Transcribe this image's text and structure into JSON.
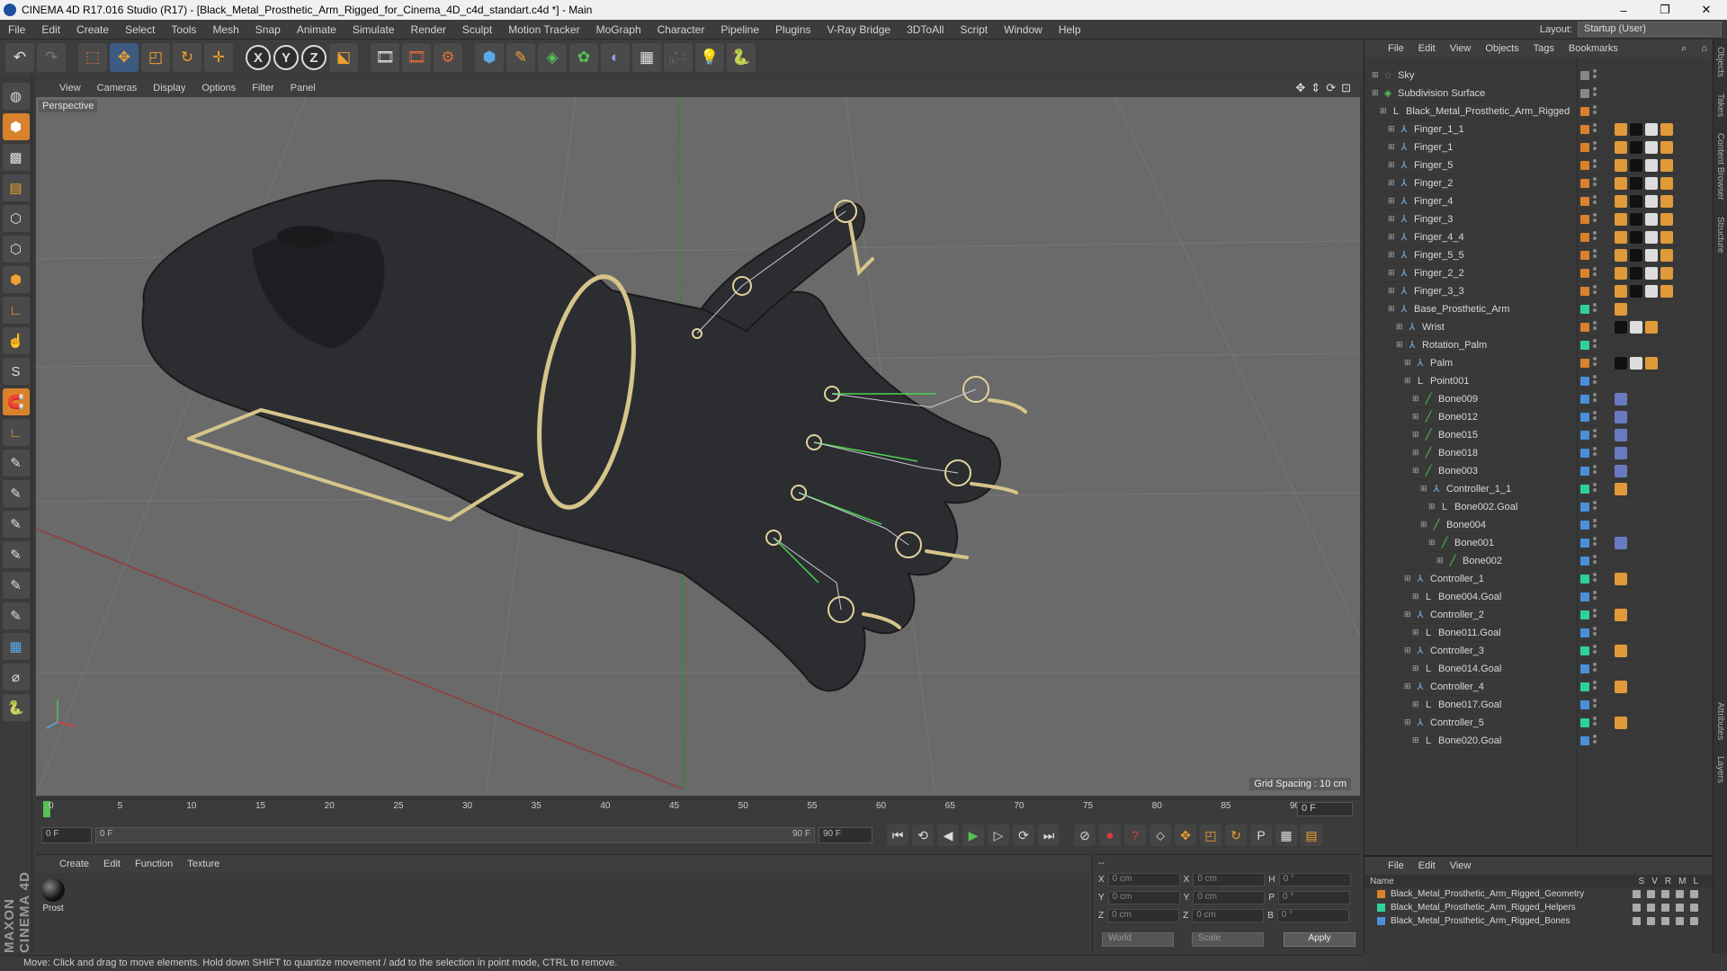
{
  "window": {
    "title": "CINEMA 4D R17.016 Studio (R17) - [Black_Metal_Prosthetic_Arm_Rigged_for_Cinema_4D_c4d_standart.c4d *] - Main",
    "controls": [
      "–",
      "❐",
      "✕"
    ]
  },
  "menubar": {
    "items": [
      "File",
      "Edit",
      "Create",
      "Select",
      "Tools",
      "Mesh",
      "Snap",
      "Animate",
      "Simulate",
      "Render",
      "Sculpt",
      "Motion Tracker",
      "MoGraph",
      "Character",
      "Pipeline",
      "Plugins",
      "V-Ray Bridge",
      "3DToAll",
      "Script",
      "Window",
      "Help"
    ],
    "layout_label": "Layout:",
    "layout_value": "Startup (User)"
  },
  "toolbar": {
    "icons": [
      "undo-icon",
      "redo-icon",
      "live-select-icon",
      "move-icon",
      "scale-icon",
      "rotate-icon",
      "transform-icon",
      "x-axis-icon",
      "y-axis-icon",
      "z-axis-icon",
      "coordinate-system-icon",
      "render-view-icon",
      "render-picture-viewer-icon",
      "edit-render-settings-icon",
      "cube-icon",
      "pen-icon",
      "subdivision-icon",
      "cloner-icon",
      "deformer-icon",
      "floor-icon",
      "camera-icon",
      "light-icon",
      "python-icon"
    ],
    "axis_labels": [
      "X",
      "Y",
      "Z"
    ]
  },
  "viewport": {
    "menu": [
      "View",
      "Cameras",
      "Display",
      "Options",
      "Filter",
      "Panel"
    ],
    "label": "Perspective",
    "grid_spacing": "Grid Spacing : 10 cm",
    "bg_color": "#6a6a6a"
  },
  "timeline": {
    "ticks": [
      "0",
      "5",
      "10",
      "15",
      "20",
      "25",
      "30",
      "35",
      "40",
      "45",
      "50",
      "55",
      "60",
      "65",
      "70",
      "75",
      "80",
      "85",
      "90"
    ],
    "current_frame": "0 F"
  },
  "transport": {
    "start_field": "0 F",
    "range_start": "0 F",
    "range_end": "90 F",
    "end_field": "90 F"
  },
  "material_manager": {
    "menu": [
      "Create",
      "Edit",
      "Function",
      "Texture"
    ],
    "material_name": "Prost"
  },
  "coord_manager": {
    "rows": [
      {
        "a": "X",
        "av": "0 cm",
        "b": "X",
        "bv": "0 cm",
        "c": "H",
        "cv": "0 °"
      },
      {
        "a": "Y",
        "av": "0 cm",
        "b": "Y",
        "bv": "0 cm",
        "c": "P",
        "cv": "0 °"
      },
      {
        "a": "Z",
        "av": "0 cm",
        "b": "Z",
        "bv": "0 cm",
        "c": "B",
        "cv": "0 °"
      }
    ],
    "header": "--",
    "world": "World",
    "scale": "Scale",
    "apply": "Apply"
  },
  "statusbar": {
    "text": "Move: Click and drag to move elements. Hold down SHIFT to quantize movement / add to the selection in point mode, CTRL to remove."
  },
  "object_manager": {
    "menu": [
      "File",
      "Edit",
      "View",
      "Objects",
      "Tags",
      "Bookmarks"
    ],
    "objects": [
      {
        "name": "Sky",
        "indent": 0,
        "icon": "sky-icon",
        "color": "#888888",
        "tags": []
      },
      {
        "name": "Subdivision Surface",
        "indent": 0,
        "icon": "subdivision-icon",
        "color": "#888888",
        "tags": []
      },
      {
        "name": "Black_Metal_Prosthetic_Arm_Rigged",
        "indent": 1,
        "icon": "null-icon",
        "color": "#d9822b",
        "tags": []
      },
      {
        "name": "Finger_1_1",
        "indent": 2,
        "icon": "joint-icon",
        "color": "#d9822b",
        "tags": [
          "#e09a3a",
          "#111111",
          "#dddddd",
          "#e09a3a"
        ]
      },
      {
        "name": "Finger_1",
        "indent": 2,
        "icon": "joint-icon",
        "color": "#d9822b",
        "tags": [
          "#e09a3a",
          "#111111",
          "#dddddd",
          "#e09a3a"
        ]
      },
      {
        "name": "Finger_5",
        "indent": 2,
        "icon": "joint-icon",
        "color": "#d9822b",
        "tags": [
          "#e09a3a",
          "#111111",
          "#dddddd",
          "#e09a3a"
        ]
      },
      {
        "name": "Finger_2",
        "indent": 2,
        "icon": "joint-icon",
        "color": "#d9822b",
        "tags": [
          "#e09a3a",
          "#111111",
          "#dddddd",
          "#e09a3a"
        ]
      },
      {
        "name": "Finger_4",
        "indent": 2,
        "icon": "joint-icon",
        "color": "#d9822b",
        "tags": [
          "#e09a3a",
          "#111111",
          "#dddddd",
          "#e09a3a"
        ]
      },
      {
        "name": "Finger_3",
        "indent": 2,
        "icon": "joint-icon",
        "color": "#d9822b",
        "tags": [
          "#e09a3a",
          "#111111",
          "#dddddd",
          "#e09a3a"
        ]
      },
      {
        "name": "Finger_4_4",
        "indent": 2,
        "icon": "joint-icon",
        "color": "#d9822b",
        "tags": [
          "#e09a3a",
          "#111111",
          "#dddddd",
          "#e09a3a"
        ]
      },
      {
        "name": "Finger_5_5",
        "indent": 2,
        "icon": "joint-icon",
        "color": "#d9822b",
        "tags": [
          "#e09a3a",
          "#111111",
          "#dddddd",
          "#e09a3a"
        ]
      },
      {
        "name": "Finger_2_2",
        "indent": 2,
        "icon": "joint-icon",
        "color": "#d9822b",
        "tags": [
          "#e09a3a",
          "#111111",
          "#dddddd",
          "#e09a3a"
        ]
      },
      {
        "name": "Finger_3_3",
        "indent": 2,
        "icon": "joint-icon",
        "color": "#d9822b",
        "tags": [
          "#e09a3a",
          "#111111",
          "#dddddd",
          "#e09a3a"
        ]
      },
      {
        "name": "Base_Prosthetic_Arm",
        "indent": 2,
        "icon": "joint-icon",
        "color": "#2fd19a",
        "tags": [
          "#e09a3a"
        ]
      },
      {
        "name": "Wrist",
        "indent": 3,
        "icon": "joint-icon",
        "color": "#d9822b",
        "tags": [
          "#111111",
          "#dddddd",
          "#e09a3a"
        ]
      },
      {
        "name": "Rotation_Palm",
        "indent": 3,
        "icon": "joint-icon",
        "color": "#2fd19a",
        "tags": []
      },
      {
        "name": "Palm",
        "indent": 4,
        "icon": "joint-icon",
        "color": "#d9822b",
        "tags": [
          "#111111",
          "#dddddd",
          "#e09a3a"
        ]
      },
      {
        "name": "Point001",
        "indent": 4,
        "icon": "null-icon",
        "color": "#4a90d9",
        "tags": []
      },
      {
        "name": "Bone009",
        "indent": 5,
        "icon": "bone-icon",
        "color": "#4a90d9",
        "tags": [
          "#6a7ac0"
        ]
      },
      {
        "name": "Bone012",
        "indent": 5,
        "icon": "bone-icon",
        "color": "#4a90d9",
        "tags": [
          "#6a7ac0"
        ]
      },
      {
        "name": "Bone015",
        "indent": 5,
        "icon": "bone-icon",
        "color": "#4a90d9",
        "tags": [
          "#6a7ac0"
        ]
      },
      {
        "name": "Bone018",
        "indent": 5,
        "icon": "bone-icon",
        "color": "#4a90d9",
        "tags": [
          "#6a7ac0"
        ]
      },
      {
        "name": "Bone003",
        "indent": 5,
        "icon": "bone-icon",
        "color": "#4a90d9",
        "tags": [
          "#6a7ac0"
        ]
      },
      {
        "name": "Controller_1_1",
        "indent": 6,
        "icon": "joint-icon",
        "color": "#2fd19a",
        "tags": [
          "#e09a3a"
        ]
      },
      {
        "name": "Bone002.Goal",
        "indent": 7,
        "icon": "null-icon",
        "color": "#4a90d9",
        "tags": []
      },
      {
        "name": "Bone004",
        "indent": 6,
        "icon": "bone-icon",
        "color": "#4a90d9",
        "tags": []
      },
      {
        "name": "Bone001",
        "indent": 7,
        "icon": "bone-icon",
        "color": "#4a90d9",
        "tags": [
          "#6a7ac0"
        ]
      },
      {
        "name": "Bone002",
        "indent": 8,
        "icon": "bone-icon",
        "color": "#4a90d9",
        "tags": []
      },
      {
        "name": "Controller_1",
        "indent": 4,
        "icon": "joint-icon",
        "color": "#2fd19a",
        "tags": [
          "#e09a3a"
        ]
      },
      {
        "name": "Bone004.Goal",
        "indent": 5,
        "icon": "null-icon",
        "color": "#4a90d9",
        "tags": []
      },
      {
        "name": "Controller_2",
        "indent": 4,
        "icon": "joint-icon",
        "color": "#2fd19a",
        "tags": [
          "#e09a3a"
        ]
      },
      {
        "name": "Bone011.Goal",
        "indent": 5,
        "icon": "null-icon",
        "color": "#4a90d9",
        "tags": []
      },
      {
        "name": "Controller_3",
        "indent": 4,
        "icon": "joint-icon",
        "color": "#2fd19a",
        "tags": [
          "#e09a3a"
        ]
      },
      {
        "name": "Bone014.Goal",
        "indent": 5,
        "icon": "null-icon",
        "color": "#4a90d9",
        "tags": []
      },
      {
        "name": "Controller_4",
        "indent": 4,
        "icon": "joint-icon",
        "color": "#2fd19a",
        "tags": [
          "#e09a3a"
        ]
      },
      {
        "name": "Bone017.Goal",
        "indent": 5,
        "icon": "null-icon",
        "color": "#4a90d9",
        "tags": []
      },
      {
        "name": "Controller_5",
        "indent": 4,
        "icon": "joint-icon",
        "color": "#2fd19a",
        "tags": [
          "#e09a3a"
        ]
      },
      {
        "name": "Bone020.Goal",
        "indent": 5,
        "icon": "null-icon",
        "color": "#4a90d9",
        "tags": []
      }
    ]
  },
  "layer_manager": {
    "menu": [
      "File",
      "Edit",
      "View"
    ],
    "name_header": "Name",
    "flags": [
      "S",
      "V",
      "R",
      "M",
      "L"
    ],
    "layers": [
      {
        "name": "Black_Metal_Prosthetic_Arm_Rigged_Geometry",
        "color": "#d9822b"
      },
      {
        "name": "Black_Metal_Prosthetic_Arm_Rigged_Helpers",
        "color": "#2fd19a"
      },
      {
        "name": "Black_Metal_Prosthetic_Arm_Rigged_Bones",
        "color": "#4a90d9"
      }
    ]
  },
  "right_tabs": [
    "Objects",
    "Takes",
    "Content Browser",
    "Structure",
    "Attributes",
    "Layers"
  ]
}
